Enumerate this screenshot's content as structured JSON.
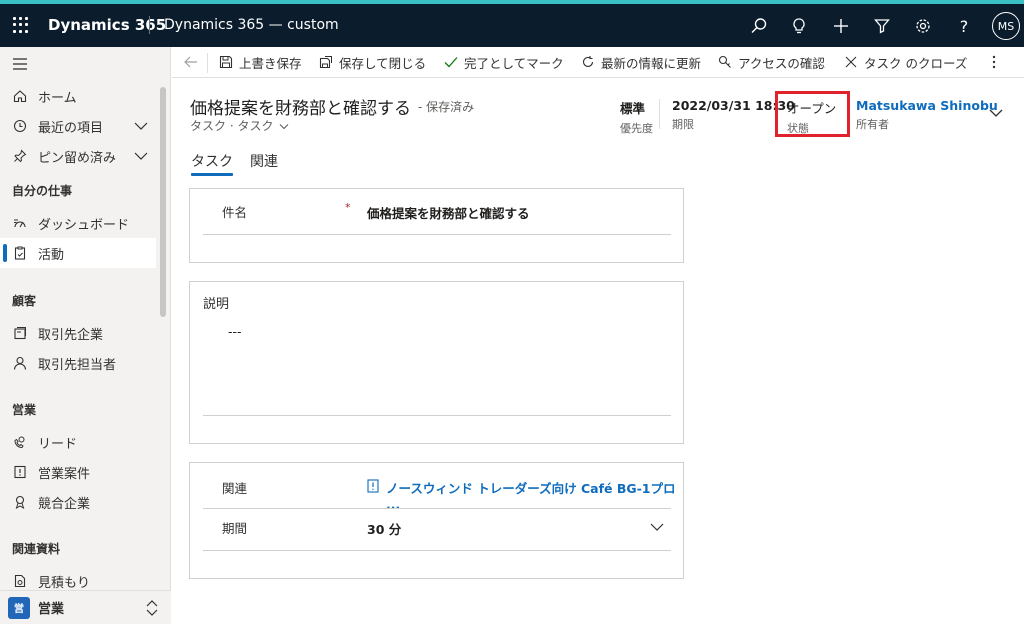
{
  "topbar": {
    "app_name": "Dynamics 365",
    "environment": "Dynamics 365 — custom",
    "avatar_initials": "MS"
  },
  "sidebar": {
    "home": "ホーム",
    "recent": "最近の項目",
    "pinned": "ピン留め済み",
    "my_work_header": "自分の仕事",
    "dashboard": "ダッシュボード",
    "activities": "活動",
    "customers_header": "顧客",
    "accounts": "取引先企業",
    "contacts": "取引先担当者",
    "sales_header": "営業",
    "leads": "リード",
    "opportunities": "営業案件",
    "competitors": "競合企業",
    "collateral_header": "関連資料",
    "quotes": "見積もり",
    "area_badge": "営",
    "area_name": "営業"
  },
  "commands": {
    "save": "上書き保存",
    "save_close": "保存して閉じる",
    "mark_complete": "完了としてマーク",
    "refresh": "最新の情報に更新",
    "check_access": "アクセスの確認",
    "close_task": "タスク のクローズ"
  },
  "header": {
    "title": "価格提案を財務部と確認する",
    "saved_status": "- 保存済み",
    "entity": "タスク",
    "form": "タスク",
    "priority_value": "標準",
    "priority_label": "優先度",
    "due_value": "2022/03/31 18:30",
    "due_label": "期限",
    "status_value": "オープン",
    "status_label": "状態",
    "owner_value": "Matsukawa Shinobu",
    "owner_label": "所有者"
  },
  "tabs": {
    "task": "タスク",
    "related": "関連"
  },
  "form": {
    "subject_label": "件名",
    "subject_value": "価格提案を財務部と確認する",
    "description_label": "説明",
    "description_value": "---",
    "regarding_label": "関連",
    "regarding_value": "ノースウィンド トレーダーズ向け Café BG-1プロ ...",
    "duration_label": "期間",
    "duration_value": "30 分"
  }
}
